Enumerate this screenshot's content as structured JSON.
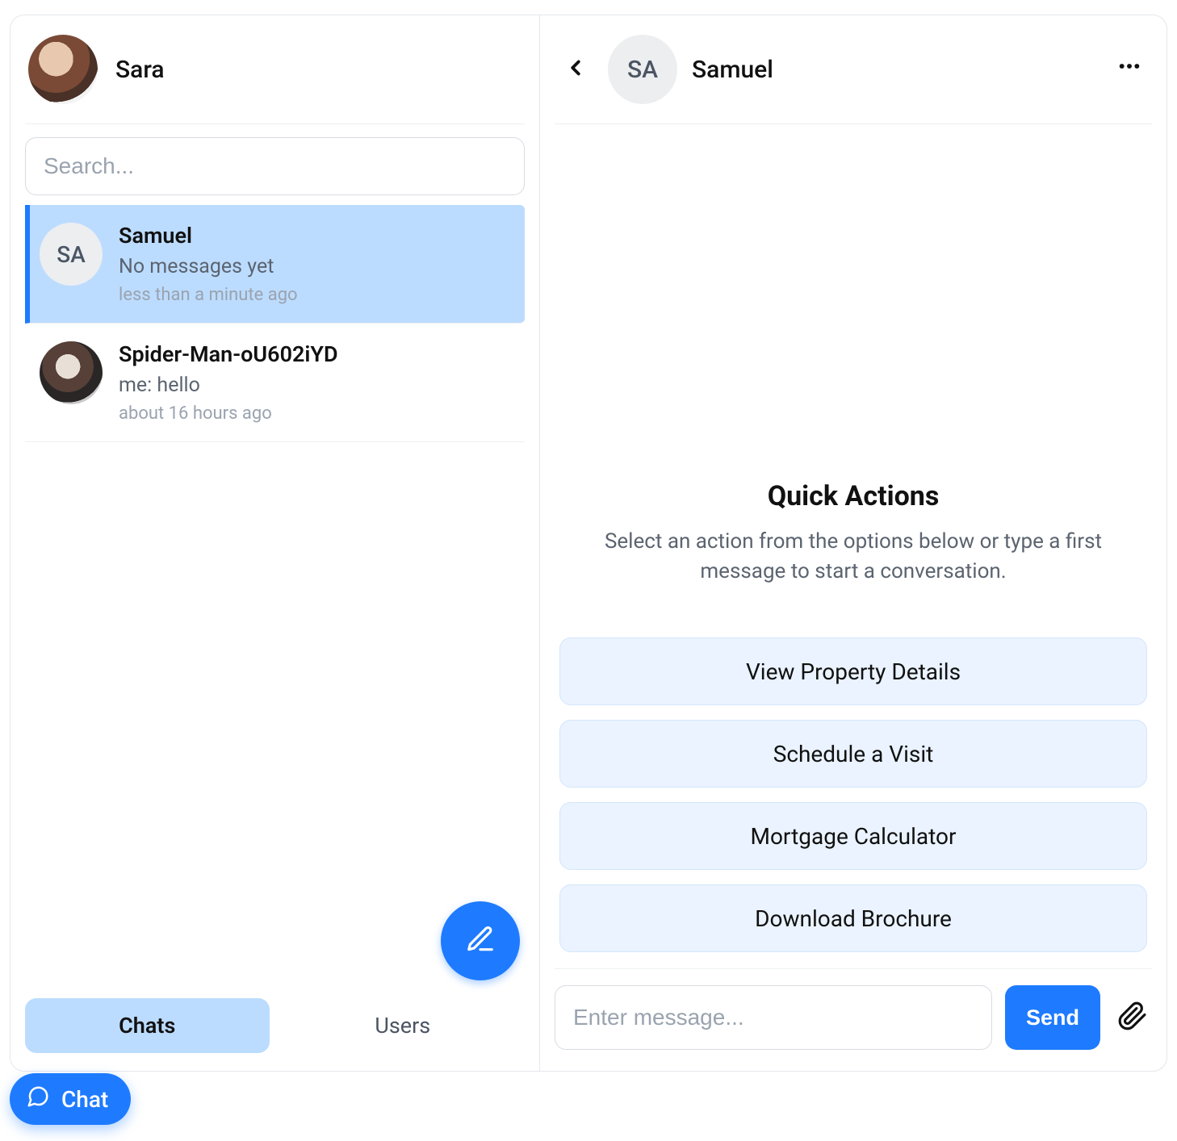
{
  "me": {
    "name": "Sara"
  },
  "search": {
    "placeholder": "Search...",
    "value": ""
  },
  "chats": [
    {
      "name": "Samuel",
      "initials": "SA",
      "preview": "No messages yet",
      "time": "less than a minute ago",
      "selected": true,
      "avatar_kind": "initials"
    },
    {
      "name": "Spider-Man-oU602iYD",
      "initials": "",
      "preview": "me: hello",
      "time": "about 16 hours ago",
      "selected": false,
      "avatar_kind": "photo"
    }
  ],
  "tabs": {
    "chats": "Chats",
    "users": "Users",
    "active": "chats"
  },
  "thread": {
    "contact_name": "Samuel",
    "contact_initials": "SA",
    "quick_actions": {
      "title": "Quick Actions",
      "subtitle": "Select an action from the options below or type a first message to start a conversation.",
      "buttons": [
        "View Property Details",
        "Schedule a Visit",
        "Mortgage Calculator",
        "Download Brochure"
      ]
    }
  },
  "composer": {
    "placeholder": "Enter message...",
    "value": "",
    "send_label": "Send"
  },
  "floating_chat_label": "Chat",
  "icons": {
    "compose": "pencil-icon",
    "back": "chevron-left-icon",
    "more": "more-horizontal-icon",
    "attach": "paperclip-icon",
    "chat": "chat-bubble-icon"
  },
  "colors": {
    "primary": "#1e7bff",
    "selection": "#bcdcff",
    "quick_action_bg": "#eaf3ff"
  }
}
